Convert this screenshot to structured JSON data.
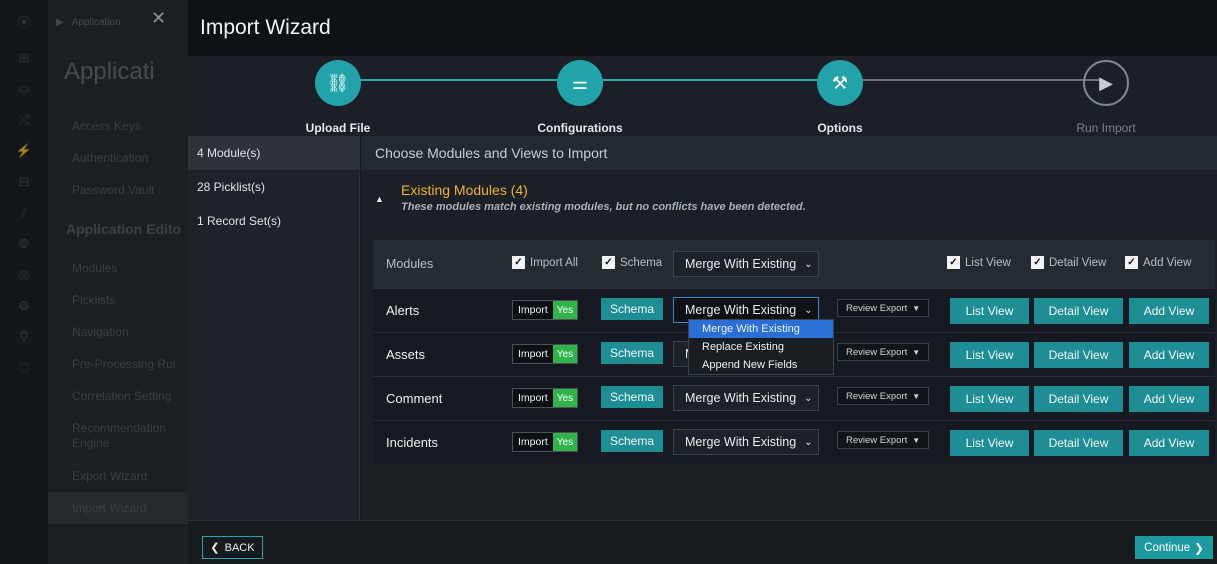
{
  "rail_icons": [
    "⦿",
    "⊞",
    "⛀",
    "⤭",
    "⚡",
    "⊟",
    "⫽",
    "⦾",
    "◎",
    "⚙",
    "⚲",
    "⎕"
  ],
  "nav": {
    "breadcrumb": "Application",
    "title": "Applicati",
    "items": [
      {
        "label": "Access Keys",
        "kind": "item"
      },
      {
        "label": "Authentication",
        "kind": "item"
      },
      {
        "label": "Password Vault",
        "kind": "item"
      },
      {
        "label": "Application Edito",
        "kind": "section"
      },
      {
        "label": "Modules",
        "kind": "item"
      },
      {
        "label": "Picklists",
        "kind": "item"
      },
      {
        "label": "Navigation",
        "kind": "item"
      },
      {
        "label": "Pre-Processing Rul",
        "kind": "item"
      },
      {
        "label": "Correlation Setting",
        "kind": "item"
      },
      {
        "label": "Recommendation Engine",
        "kind": "item"
      },
      {
        "label": "Export Wizard",
        "kind": "item"
      },
      {
        "label": "Import Wizard",
        "kind": "item"
      }
    ]
  },
  "wizard": {
    "title": "Import Wizard",
    "steps": [
      {
        "label": "Upload File",
        "icon": "⛓",
        "active": true
      },
      {
        "label": "Configurations",
        "icon": "⚌",
        "active": true
      },
      {
        "label": "Options",
        "icon": "⚒",
        "active": true
      },
      {
        "label": "Run Import",
        "icon": "▶",
        "active": false
      }
    ],
    "left_items": [
      "4 Module(s)",
      "28 Picklist(s)",
      "1 Record Set(s)"
    ],
    "content_title": "Choose Modules and Views to Import",
    "existing": {
      "title": "Existing Modules (4)",
      "subtitle": "These modules match existing modules, but no conflicts have been detected."
    },
    "header": {
      "modules": "Modules",
      "import_all": "Import All",
      "schema": "Schema",
      "merge": "Merge With Existing",
      "list_view": "List View",
      "detail_view": "Detail View",
      "add_view": "Add View"
    },
    "rows": [
      {
        "name": "Alerts",
        "import": "Import",
        "yes": "Yes",
        "schema": "Schema",
        "merge": "Merge With Existing",
        "review": "Review Export",
        "list": "List View",
        "detail": "Detail View",
        "add": "Add View"
      },
      {
        "name": "Assets",
        "import": "Import",
        "yes": "Yes",
        "schema": "Schema",
        "merge": "Merge With Existing",
        "review": "Review Export",
        "list": "List View",
        "detail": "Detail View",
        "add": "Add View"
      },
      {
        "name": "Comment",
        "import": "Import",
        "yes": "Yes",
        "schema": "Schema",
        "merge": "Merge With Existing",
        "review": "Review Export",
        "list": "List View",
        "detail": "Detail View",
        "add": "Add View"
      },
      {
        "name": "Incidents",
        "import": "Import",
        "yes": "Yes",
        "schema": "Schema",
        "merge": "Merge With Existing",
        "review": "Review Export",
        "list": "List View",
        "detail": "Detail View",
        "add": "Add View"
      }
    ],
    "dropdown_options": [
      "Merge With Existing",
      "Replace Existing",
      "Append New Fields"
    ],
    "back": "BACK",
    "continue": "Continue"
  }
}
